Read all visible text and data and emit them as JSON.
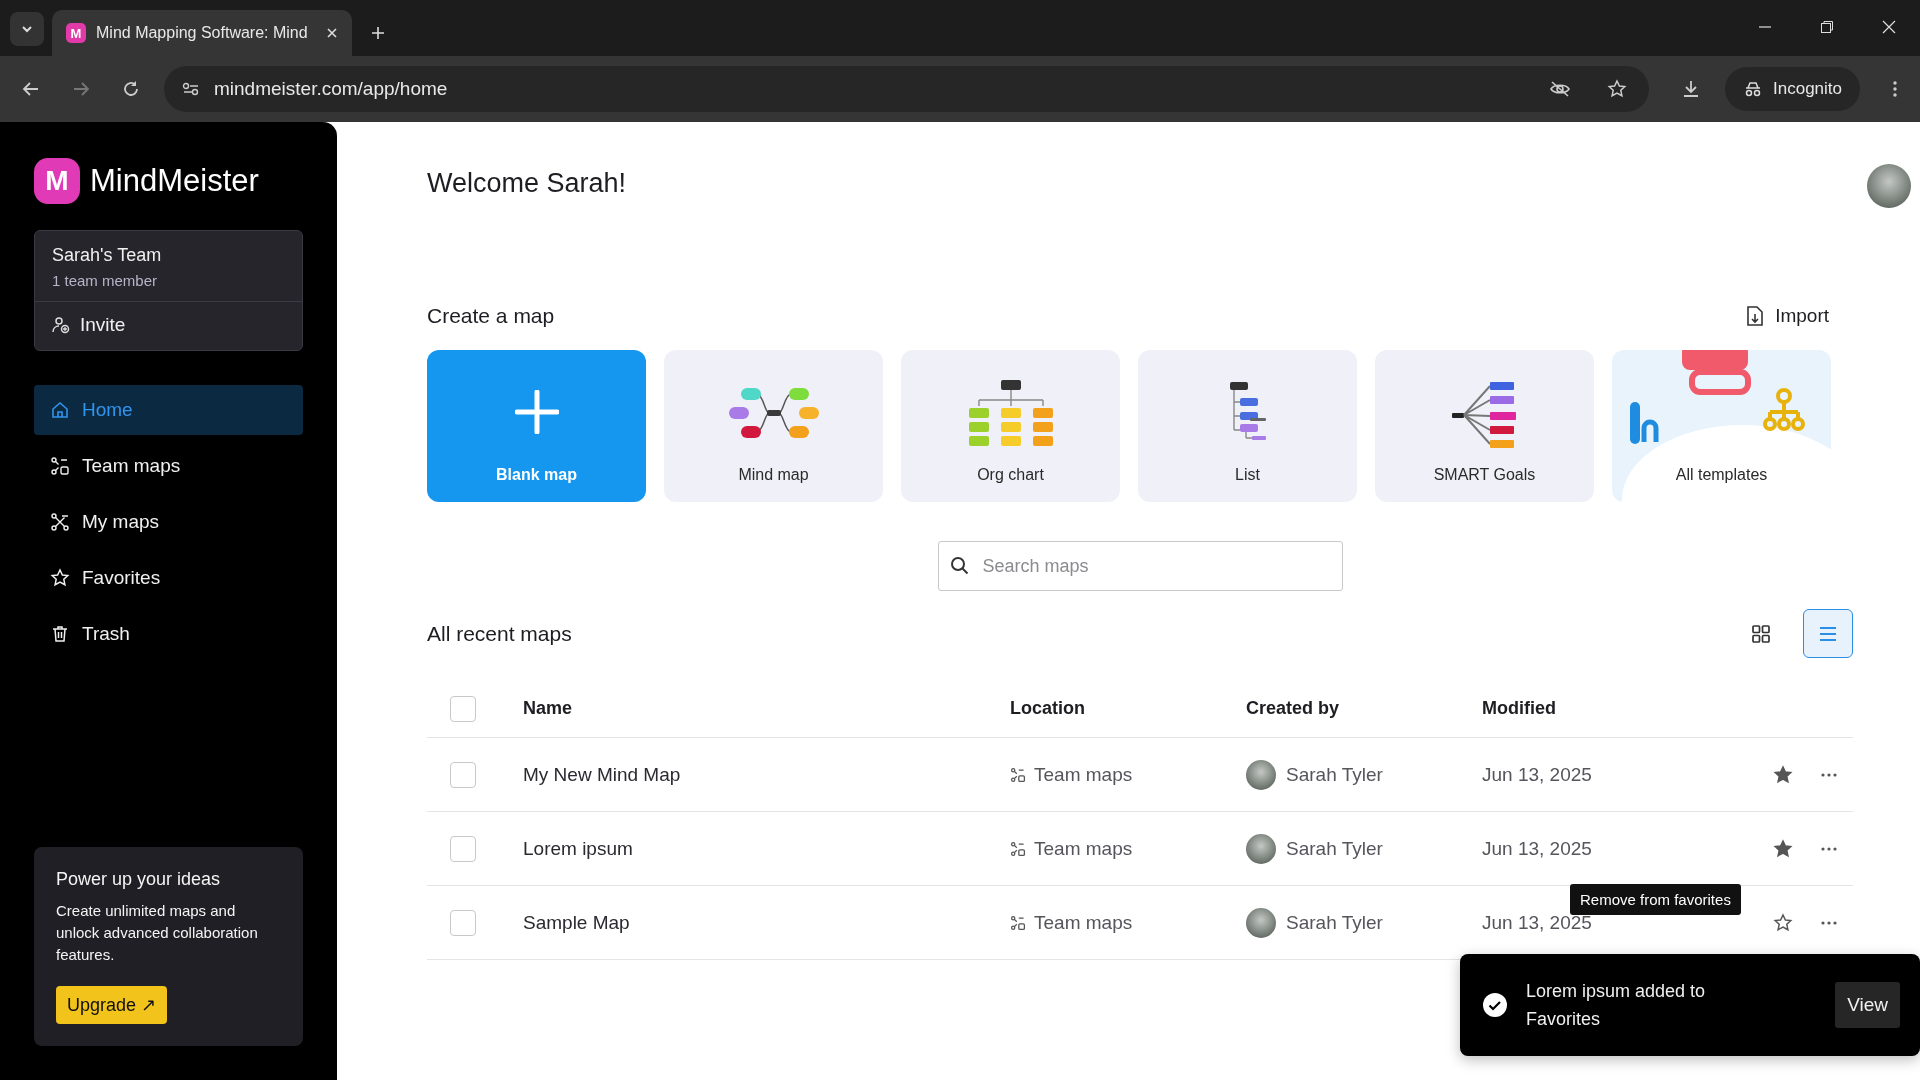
{
  "browser": {
    "tab_icon_letter": "M",
    "tab_title": "Mind Mapping Software: Mind",
    "url": "mindmeister.com/app/home",
    "incognito_label": "Incognito"
  },
  "sidebar": {
    "logo_letter": "M",
    "logo_text": "MindMeister",
    "team": {
      "name": "Sarah's Team",
      "members": "1 team member",
      "invite": "Invite"
    },
    "nav": [
      {
        "kind": "home",
        "label": "Home",
        "selected": true
      },
      {
        "kind": "team",
        "label": "Team maps",
        "selected": false
      },
      {
        "kind": "mine",
        "label": "My maps",
        "selected": false
      },
      {
        "kind": "star",
        "label": "Favorites",
        "selected": false
      },
      {
        "kind": "trash",
        "label": "Trash",
        "selected": false
      }
    ],
    "promo": {
      "title": "Power up your ideas",
      "text": "Create unlimited maps and unlock advanced collaboration features.",
      "button": "Upgrade ↗"
    }
  },
  "main": {
    "welcome": "Welcome Sarah!",
    "create_title": "Create a map",
    "import_label": "Import",
    "templates": [
      {
        "kind": "blank",
        "label": "Blank map"
      },
      {
        "kind": "mind",
        "label": "Mind map"
      },
      {
        "kind": "org",
        "label": "Org chart"
      },
      {
        "kind": "list",
        "label": "List"
      },
      {
        "kind": "smart",
        "label": "SMART Goals"
      },
      {
        "kind": "all",
        "label": "All templates"
      }
    ],
    "search": {
      "placeholder": "Search maps"
    },
    "recent_title": "All recent maps",
    "views": [
      {
        "kind": "grid",
        "selected": false
      },
      {
        "kind": "list",
        "selected": true
      }
    ],
    "table": {
      "columns": [
        "Name",
        "Location",
        "Created by",
        "Modified"
      ],
      "header_checked": false,
      "rows": [
        {
          "name": "My New Mind Map",
          "location": "Team maps",
          "created_by": "Sarah Tyler",
          "modified": "Jun 13, 2025",
          "checked": false,
          "favorite": true
        },
        {
          "name": "Lorem ipsum",
          "location": "Team maps",
          "created_by": "Sarah Tyler",
          "modified": "Jun 13, 2025",
          "checked": false,
          "favorite": true
        },
        {
          "name": "Sample Map",
          "location": "Team maps",
          "created_by": "Sarah Tyler",
          "modified": "Jun 13, 2025",
          "checked": false,
          "favorite": false
        }
      ]
    },
    "tooltip": "Remove from favorites",
    "toast": {
      "message": "Lorem ipsum added to Favorites",
      "action": "View"
    }
  }
}
